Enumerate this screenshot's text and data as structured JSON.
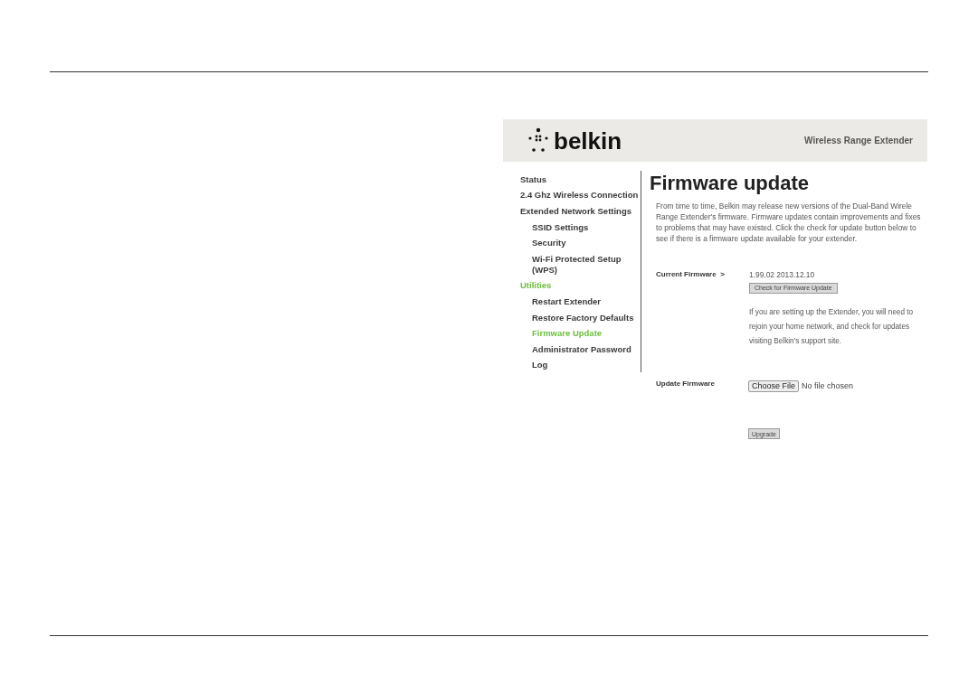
{
  "header": {
    "logo": "belkin",
    "product": "Wireless Range Extender"
  },
  "nav": [
    {
      "label": "Status",
      "selected": false
    },
    {
      "label": "2.4 Ghz Wireless Connection",
      "selected": false
    },
    {
      "label": "Extended Network Settings",
      "selected": false,
      "children": [
        {
          "label": "SSID Settings",
          "selected": false
        },
        {
          "label": "Security",
          "selected": false
        },
        {
          "label": "Wi-Fi Protected Setup (WPS)",
          "selected": false
        }
      ]
    },
    {
      "label": "Utilities",
      "selected": true,
      "children": [
        {
          "label": "Restart Extender",
          "selected": false
        },
        {
          "label": "Restore Factory Defaults",
          "selected": false
        },
        {
          "label": "Firmware Update",
          "selected": true
        },
        {
          "label": "Administrator Password",
          "selected": false
        },
        {
          "label": "Log",
          "selected": false
        }
      ]
    }
  ],
  "content": {
    "title": "Firmware update",
    "intro": "From time to time, Belkin may release new versions of the Dual-Band Wirele Range Extender's firmware. Firmware updates contain improvements and fixes to problems that may have existed. Click the check for update button below to see if there is a firmware update available for your extender.",
    "current_label": "Current Firmware  >",
    "current_value": "1.99.02 2013.12.10",
    "check_button": "Check for Firmware Update",
    "note": "If you are setting up the Extender, you will need to rejoin your home network, and check for updates visiting Belkin's support site.",
    "update_label": "Update Firmware",
    "choose_button": "Choose File",
    "file_status": "No file chosen",
    "upgrade_button": "Upgrade"
  }
}
